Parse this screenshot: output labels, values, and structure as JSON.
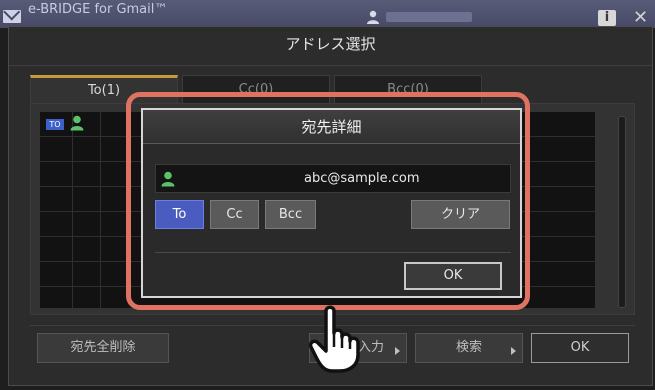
{
  "appbar": {
    "title": "e-BRIDGE  for Gmail™",
    "icons": [
      "mail-icon",
      "user-icon",
      "info-icon",
      "close-icon"
    ]
  },
  "address_dialog": {
    "title": "アドレス選択",
    "tabs": [
      {
        "label": "To(1)",
        "active": true
      },
      {
        "label": "Cc(0)",
        "active": false
      },
      {
        "label": "Bcc(0)",
        "active": false
      }
    ],
    "list": {
      "rows": [
        {
          "type_badge": "TO",
          "icon": "user-icon"
        }
      ]
    },
    "footer": {
      "clear_all": "宛先全削除",
      "manual_input": "直接入力",
      "search": "検索",
      "ok": "OK"
    }
  },
  "detail_popup": {
    "title": "宛先詳細",
    "address": "abc@sample.com",
    "type_buttons": [
      {
        "label": "To",
        "selected": true
      },
      {
        "label": "Cc",
        "selected": false
      },
      {
        "label": "Bcc",
        "selected": false
      }
    ],
    "clear": "クリア",
    "ok": "OK"
  },
  "colors": {
    "accent_tab": "#c79b3b",
    "selected_button": "#4a5cc0",
    "highlight_ring": "#e07262",
    "user_icon": "#5cc26a"
  }
}
